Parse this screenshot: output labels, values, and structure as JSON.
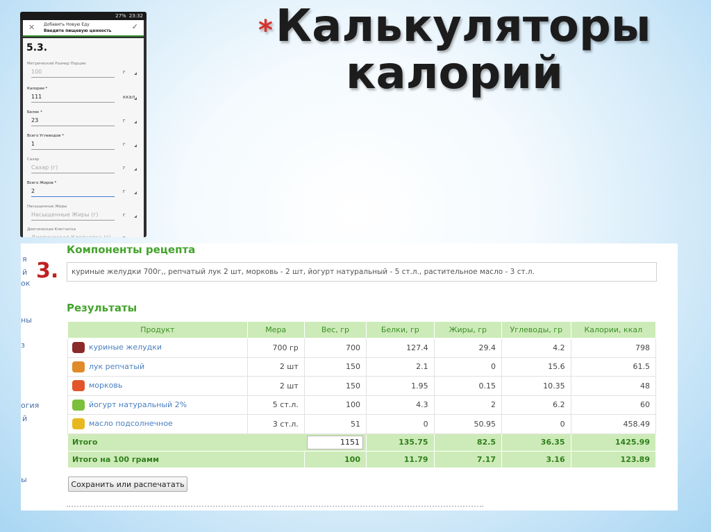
{
  "slide": {
    "star": "*",
    "title_line1": "Калькуляторы",
    "title_line2": "калорий"
  },
  "phone": {
    "status_battery": "27%",
    "status_time": "23:32",
    "app_title": "Добавить Новую Еду",
    "app_subtitle": "Введите пищевую ценность",
    "step_label": "5.3.",
    "fields": [
      {
        "label": "Метрический Размер Порции",
        "value": "100",
        "unit": "г",
        "required": false,
        "muted": true
      },
      {
        "label": "Калории *",
        "value": "111",
        "unit": "ккал",
        "required": true,
        "muted": false
      },
      {
        "label": "Белок *",
        "value": "23",
        "unit": "г",
        "required": true,
        "muted": false
      },
      {
        "label": "Всего Углеводов *",
        "value": "1",
        "unit": "г",
        "required": true,
        "muted": false
      },
      {
        "label": "Сахар",
        "value": "Сахар (г)",
        "unit": "г",
        "required": false,
        "muted": true
      },
      {
        "label": "Всего Жиров *",
        "value": "2",
        "unit": "г",
        "required": true,
        "muted": false
      },
      {
        "label": "Насыщенные Жиры",
        "value": "Насыщенные Жиры (г)",
        "unit": "г",
        "required": false,
        "muted": true
      },
      {
        "label": "Диетическая Клетчатка",
        "value": "Диетическая Клетчатка (г)",
        "unit": "г",
        "required": false,
        "muted": true
      }
    ]
  },
  "web": {
    "sidebar_fragments": [
      "я",
      "й",
      "ок",
      "ны",
      "з",
      "огия",
      "й",
      "ы"
    ],
    "step_label": "3.",
    "components_heading": "Компоненты рецепта",
    "ingredients_text": "куриные желудки 700г,, репчатый лук 2 шт, морковь - 2 шт, йогурт натуральный - 5 ст.л., растительное масло - 3 ст.л.",
    "results_heading": "Результаты",
    "table": {
      "headers": [
        "Продукт",
        "Мера",
        "Вес, гр",
        "Белки, гр",
        "Жиры, гр",
        "Углеводы, гр",
        "Калории, ккал"
      ],
      "rows": [
        {
          "icon": "chicken-gizzards-icon",
          "icon_color": "#8b2a2a",
          "product": "куриные желудки",
          "measure": "700 гр",
          "weight": "700",
          "protein": "127.4",
          "fat": "29.4",
          "carbs": "4.2",
          "kcal": "798"
        },
        {
          "icon": "onion-icon",
          "icon_color": "#e08a2a",
          "product": "лук репчатый",
          "measure": "2 шт",
          "weight": "150",
          "protein": "2.1",
          "fat": "0",
          "carbs": "15.6",
          "kcal": "61.5"
        },
        {
          "icon": "carrot-icon",
          "icon_color": "#e2552a",
          "product": "морковь",
          "measure": "2 шт",
          "weight": "150",
          "protein": "1.95",
          "fat": "0.15",
          "carbs": "10.35",
          "kcal": "48"
        },
        {
          "icon": "yogurt-icon",
          "icon_color": "#7cbf3a",
          "product": "йогурт натуральный 2%",
          "measure": "5 ст.л.",
          "weight": "100",
          "protein": "4.3",
          "fat": "2",
          "carbs": "6.2",
          "kcal": "60"
        },
        {
          "icon": "sunflower-oil-icon",
          "icon_color": "#e8b820",
          "product": "масло подсолнечное",
          "measure": "3 ст.л.",
          "weight": "51",
          "protein": "0",
          "fat": "50.95",
          "carbs": "0",
          "kcal": "458.49"
        }
      ],
      "total": {
        "label": "Итого",
        "weight": "1151",
        "protein": "135.75",
        "fat": "82.5",
        "carbs": "36.35",
        "kcal": "1425.99"
      },
      "per100": {
        "label": "Итого на 100 грамм",
        "weight": "100",
        "protein": "11.79",
        "fat": "7.17",
        "carbs": "3.16",
        "kcal": "123.89"
      }
    },
    "save_button": "Сохранить или распечатать"
  }
}
